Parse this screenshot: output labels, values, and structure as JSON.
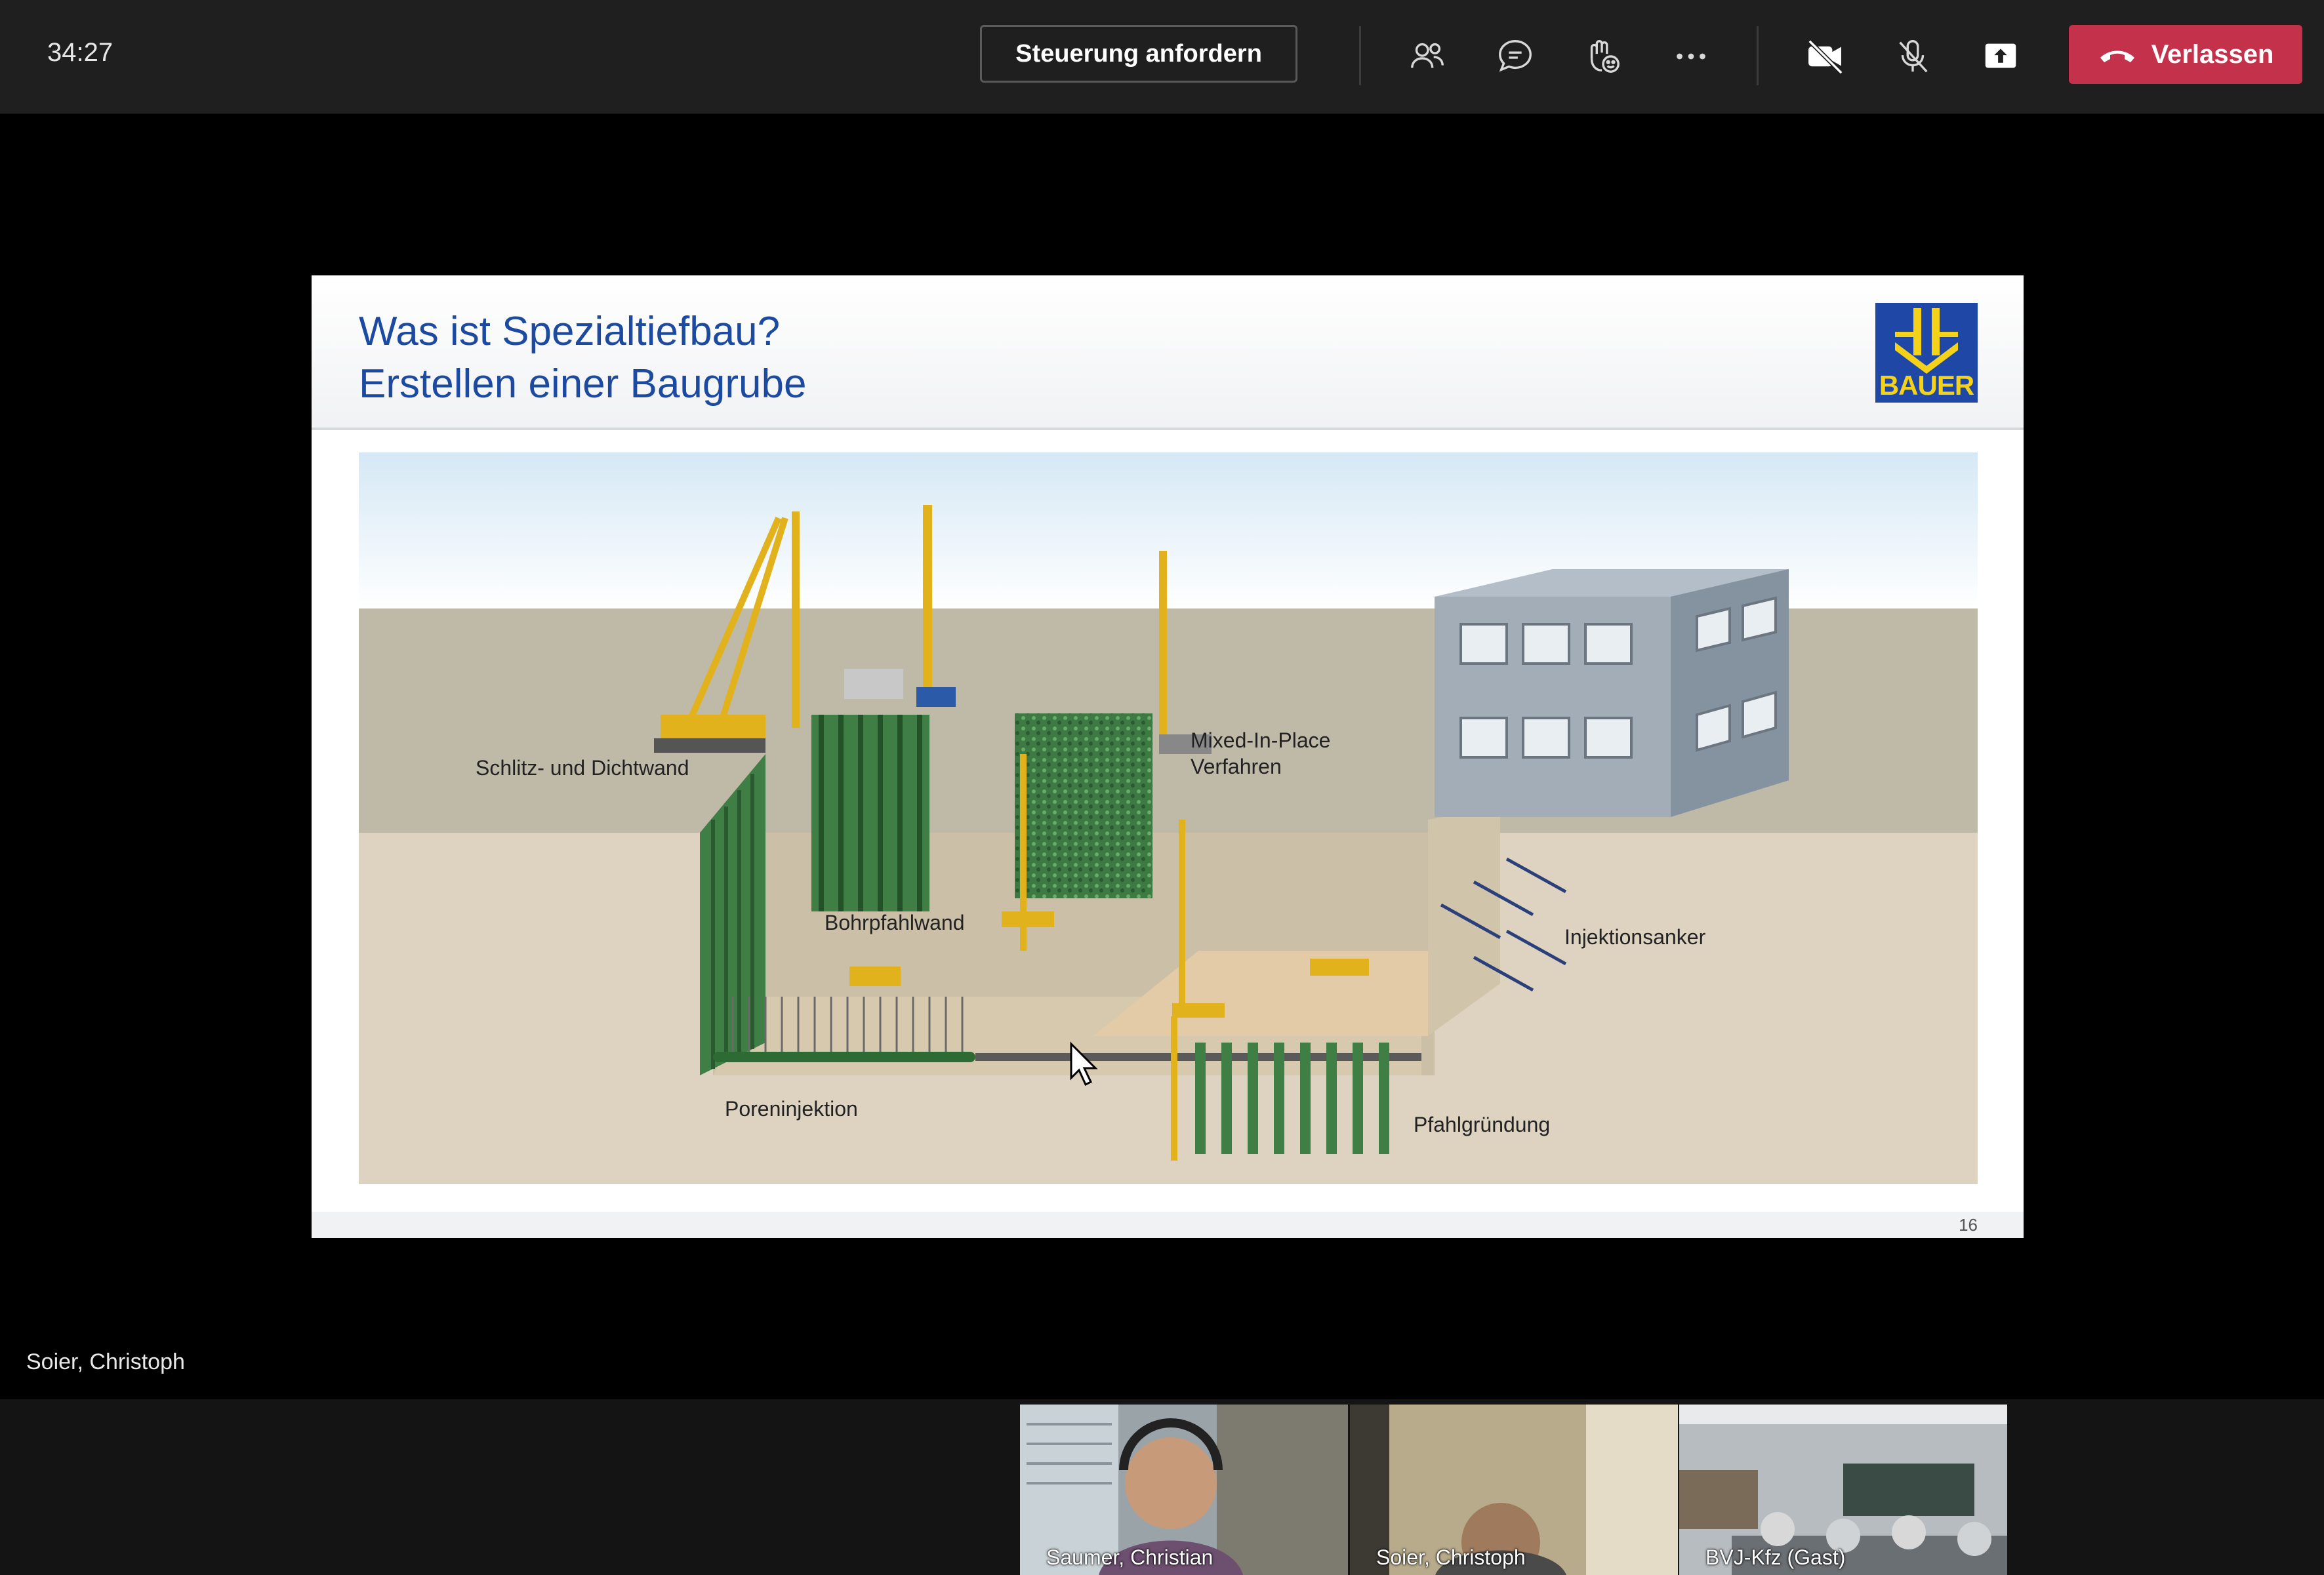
{
  "toolbar": {
    "timer": "34:27",
    "request_control_label": "Steuerung anfordern",
    "leave_label": "Verlassen",
    "icons": [
      "participants-icon",
      "chat-icon",
      "reactions-icon",
      "more-options-icon",
      "camera-off-icon",
      "mic-off-icon",
      "share-screen-icon",
      "hang-up-icon"
    ],
    "leave_color": "#c4314b"
  },
  "slide": {
    "title_line1": "Was ist Spezialtiefbau?",
    "title_line2": "Erstellen einer Baugrube",
    "logo_text": "BAUER",
    "page_number": "16",
    "title_color": "#1c4aa0",
    "labels": {
      "schlitz": "Schlitz- und Dichtwand",
      "bohrpfahl": "Bohrpfahlwand",
      "mixed_line1": "Mixed-In-Place",
      "mixed_line2": "Verfahren",
      "injektion": "Injektionsanker",
      "poren": "Poreninjektion",
      "pfahl": "Pfahlgründung"
    }
  },
  "presenter": {
    "name": "Soier, Christoph"
  },
  "participants": [
    {
      "name": "Saumer, Christian"
    },
    {
      "name": "Soier, Christoph"
    },
    {
      "name": "BVJ-Kfz (Gast)"
    }
  ]
}
